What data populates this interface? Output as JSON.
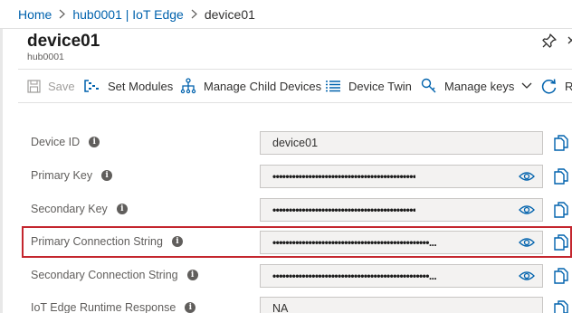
{
  "breadcrumb": {
    "items": [
      "Home",
      "hub0001 | IoT Edge",
      "device01"
    ]
  },
  "header": {
    "title": "device01",
    "subtitle": "hub0001"
  },
  "toolbar": {
    "save_label": "Save",
    "set_modules_label": "Set Modules",
    "manage_child_devices_label": "Manage Child Devices",
    "device_twin_label": "Device Twin",
    "manage_keys_label": "Manage keys",
    "refresh_label": "Re"
  },
  "form": {
    "fields": [
      {
        "label": "Device ID",
        "value": "device01",
        "masked": false
      },
      {
        "label": "Primary Key",
        "value": "••••••••••••••••••••••••••••••••••••••••••••",
        "masked": true
      },
      {
        "label": "Secondary Key",
        "value": "••••••••••••••••••••••••••••••••••••••••••••",
        "masked": true
      },
      {
        "label": "Primary Connection String",
        "value": "••••••••••••••••••••••••••••••••••••••••••••••••...",
        "masked": true
      },
      {
        "label": "Secondary Connection String",
        "value": "••••••••••••••••••••••••••••••••••••••••••••••••...",
        "masked": true
      },
      {
        "label": "IoT Edge Runtime Response",
        "value": "NA",
        "masked": false
      }
    ]
  },
  "colors": {
    "accent": "#0062ad",
    "highlight_border": "#c4262e"
  }
}
